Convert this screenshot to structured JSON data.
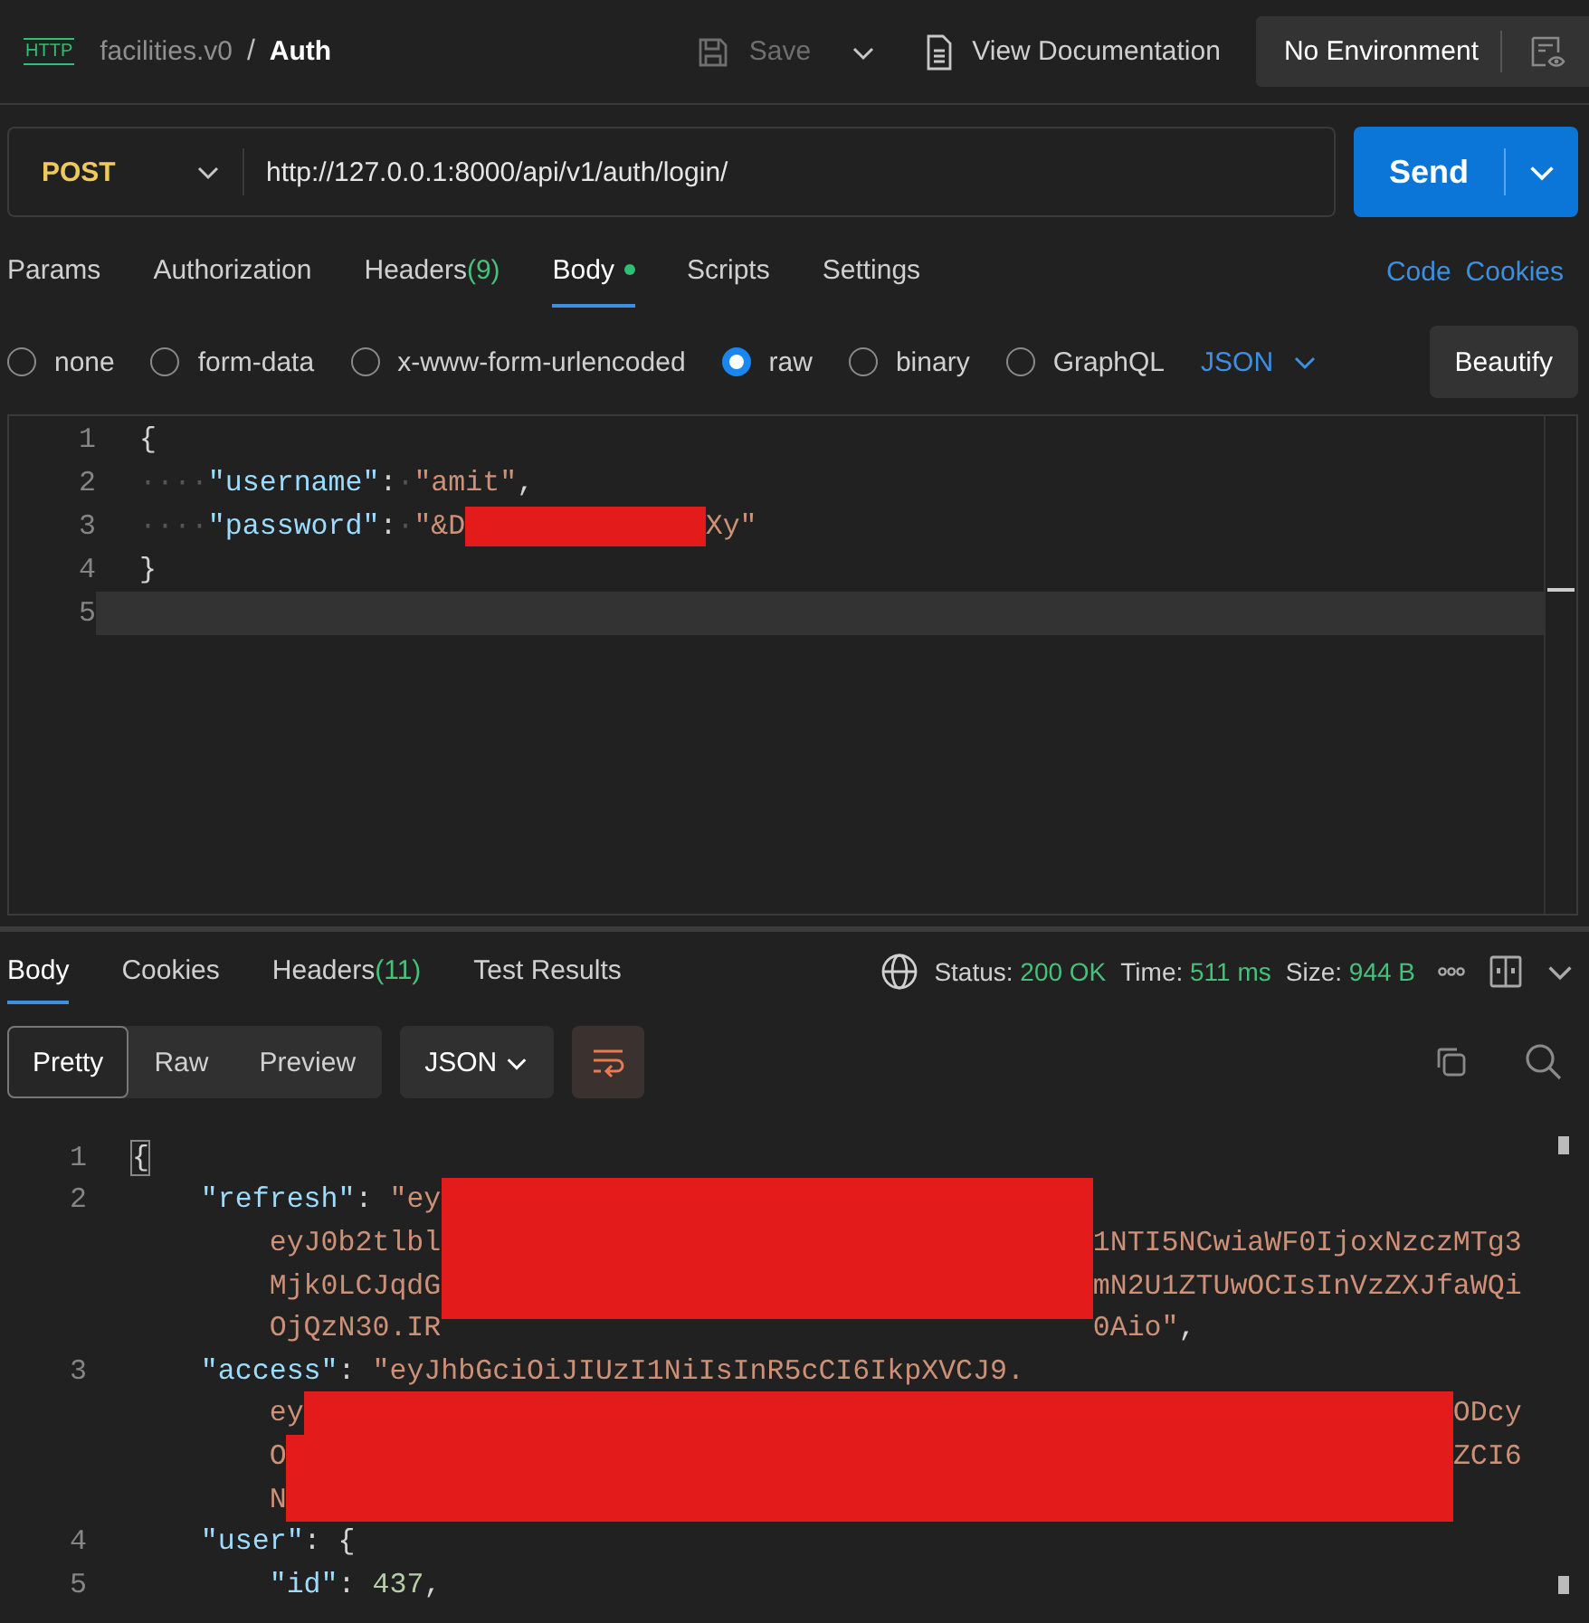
{
  "header": {
    "badge": "HTTP",
    "workspace": "facilities.v0",
    "separator": "/",
    "title": "Auth",
    "save": {
      "label": "Save",
      "disabled": true
    },
    "docs": "View Documentation",
    "environment": "No Environment"
  },
  "request": {
    "method": "POST",
    "url": "http://127.0.0.1:8000/api/v1/auth/login/",
    "send": "Send"
  },
  "request_tabs": [
    {
      "label": "Params",
      "selected": false
    },
    {
      "label": "Authorization",
      "selected": false
    },
    {
      "label": "Headers",
      "count": "(9)",
      "selected": false
    },
    {
      "label": "Body",
      "selected": true,
      "dot": true
    },
    {
      "label": "Scripts",
      "selected": false
    },
    {
      "label": "Settings",
      "selected": false
    }
  ],
  "links": [
    "Code",
    "Cookies"
  ],
  "body_types": [
    {
      "label": "none",
      "selected": false
    },
    {
      "label": "form-data",
      "selected": false
    },
    {
      "label": "x-www-form-urlencoded",
      "selected": false
    },
    {
      "label": "raw",
      "selected": true
    },
    {
      "label": "binary",
      "selected": false
    },
    {
      "label": "GraphQL",
      "selected": false
    }
  ],
  "format": "JSON",
  "beautify": "Beautify",
  "request_body": [
    {
      "number": "1",
      "active": false,
      "parts": [
        {
          "t": "{",
          "kind": "punct"
        }
      ]
    },
    {
      "number": "2",
      "active": false,
      "parts": [
        {
          "t": "····",
          "kind": "ws"
        },
        {
          "t": "\"username\"",
          "kind": "key"
        },
        {
          "t": ":",
          "kind": "punct"
        },
        {
          "t": "·",
          "kind": "ws"
        },
        {
          "t": "\"amit\"",
          "kind": "str"
        },
        {
          "t": ",",
          "kind": "punct"
        }
      ]
    },
    {
      "number": "3",
      "active": false,
      "parts": [
        {
          "t": "····",
          "kind": "ws"
        },
        {
          "t": "\"password\"",
          "kind": "key"
        },
        {
          "t": ":",
          "kind": "punct"
        },
        {
          "t": "·",
          "kind": "ws"
        },
        {
          "t": "\"&D",
          "kind": "str"
        },
        {
          "kind": "redacted"
        },
        {
          "t": "Xy\"",
          "kind": "str"
        }
      ]
    },
    {
      "number": "4",
      "active": false,
      "parts": [
        {
          "t": "}",
          "kind": "punct"
        }
      ]
    },
    {
      "number": "5",
      "active": true
    }
  ],
  "response_tabs": [
    {
      "label": "Body",
      "selected": true
    },
    {
      "label": "Cookies",
      "selected": false
    },
    {
      "label": "Headers",
      "count": "(11)",
      "selected": false
    },
    {
      "label": "Test Results",
      "selected": false
    }
  ],
  "status": [
    {
      "label": "Status:",
      "value": "200 OK"
    },
    {
      "label": "Time:",
      "value": "511 ms"
    },
    {
      "label": "Size:",
      "value": "944 B"
    }
  ],
  "view_modes": [
    {
      "label": "Pretty",
      "selected": true
    },
    {
      "label": "Raw",
      "selected": false
    },
    {
      "label": "Preview",
      "selected": false
    }
  ],
  "response_format": "JSON",
  "response_body": [
    {
      "number": "1",
      "parts": [
        {
          "t": "{",
          "kind": "bracket"
        }
      ]
    },
    {
      "number": "2",
      "parts": [
        {
          "t": "    \"refresh\"",
          "kind": "key"
        },
        {
          "t": ": ",
          "kind": "punct"
        },
        {
          "t": "\"ey",
          "kind": "str"
        },
        {
          "kind": "redacted"
        }
      ]
    },
    {
      "parts": [
        {
          "t": "        eyJ0b2tlbl",
          "kind": "str"
        },
        {
          "kind": "redacted"
        },
        {
          "t": "1NTI5NCwiaWF0IjoxNzczMTg3",
          "kind": "str"
        }
      ]
    },
    {
      "parts": [
        {
          "t": "        Mjk0LCJqdG",
          "kind": "str"
        },
        {
          "kind": "redacted"
        },
        {
          "t": "mN2U1ZTUwOCIsInVzZXJfaWQi",
          "kind": "str"
        }
      ]
    },
    {
      "parts": [
        {
          "t": "        OjQzN30.IR",
          "kind": "str"
        },
        {
          "kind": "redacted"
        },
        {
          "t": "0Aio\"",
          "kind": "str"
        },
        {
          "t": ",",
          "kind": "punct"
        }
      ]
    },
    {
      "number": "3",
      "parts": [
        {
          "t": "    \"access\"",
          "kind": "key"
        },
        {
          "t": ": ",
          "kind": "punct"
        },
        {
          "t": "\"eyJhbGciOiJIUzI1NiIsInR5cCI6IkpXVCJ9.",
          "kind": "str"
        }
      ]
    },
    {
      "parts": [
        {
          "t": "        ey",
          "kind": "str"
        },
        {
          "kind": "redacted"
        },
        {
          "t": "ODcy",
          "kind": "str"
        }
      ]
    },
    {
      "parts": [
        {
          "t": "        O",
          "kind": "str"
        },
        {
          "kind": "redacted"
        },
        {
          "t": "ZCI6",
          "kind": "str"
        }
      ]
    },
    {
      "parts": [
        {
          "t": "        N",
          "kind": "str"
        },
        {
          "kind": "redacted"
        }
      ]
    },
    {
      "number": "4",
      "parts": [
        {
          "t": "    \"user\"",
          "kind": "key"
        },
        {
          "t": ": {",
          "kind": "punct"
        }
      ]
    },
    {
      "number": "5",
      "parts": [
        {
          "t": "        \"id\"",
          "kind": "key"
        },
        {
          "t": ": ",
          "kind": "punct"
        },
        {
          "t": "437",
          "kind": "num"
        },
        {
          "t": ",",
          "kind": "punct"
        }
      ]
    }
  ]
}
